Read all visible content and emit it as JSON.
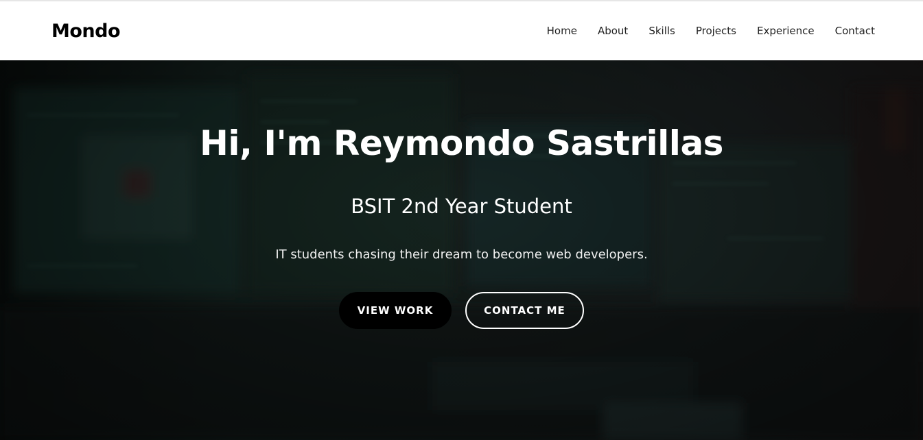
{
  "navbar": {
    "brand": "Mondo",
    "links": [
      "Home",
      "About",
      "Skills",
      "Projects",
      "Experience",
      "Contact"
    ]
  },
  "hero": {
    "title": "Hi, I'm Reymondo Sastrillas",
    "subtitle": "BSIT 2nd Year Student",
    "tagline": "IT students chasing their dream to become web developers.",
    "primary_button": "VIEW WORK",
    "secondary_button": "CONTACT ME",
    "background_description_icon": "code-monitor-background"
  },
  "colors": {
    "nav_bg": "#ffffff",
    "brand_text": "#000000",
    "hero_text": "#ffffff",
    "primary_btn_bg": "#000000",
    "hero_tint": "#1c2a28"
  }
}
